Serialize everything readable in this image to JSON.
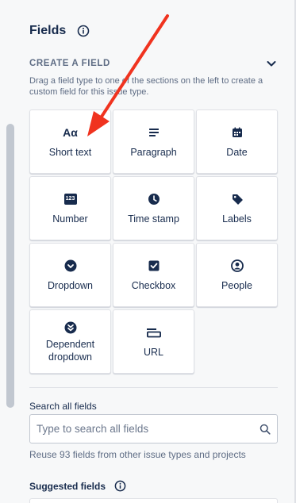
{
  "header": {
    "title": "Fields"
  },
  "create_section": {
    "title": "CREATE A FIELD",
    "description": "Drag a field type to one of the sections on the left to create a custom field for this issue type."
  },
  "field_types": [
    {
      "label": "Short text",
      "icon": "short-text-icon"
    },
    {
      "label": "Paragraph",
      "icon": "paragraph-icon"
    },
    {
      "label": "Date",
      "icon": "calendar-icon"
    },
    {
      "label": "Number",
      "icon": "number-icon"
    },
    {
      "label": "Time stamp",
      "icon": "clock-icon"
    },
    {
      "label": "Labels",
      "icon": "tag-icon"
    },
    {
      "label": "Dropdown",
      "icon": "dropdown-icon"
    },
    {
      "label": "Checkbox",
      "icon": "checkbox-icon"
    },
    {
      "label": "People",
      "icon": "person-icon"
    },
    {
      "label": "Dependent dropdown",
      "icon": "dependent-dropdown-icon"
    },
    {
      "label": "URL",
      "icon": "url-icon"
    }
  ],
  "icon_glyphs": {
    "short_text": "Aα",
    "number": "123"
  },
  "search": {
    "label": "Search all fields",
    "placeholder": "Type to search all fields",
    "value": "",
    "help": "Reuse 93 fields from other issue types and projects"
  },
  "suggested": {
    "title": "Suggested fields"
  },
  "colors": {
    "icon": "#172b4d",
    "annotation_arrow": "#f0331f",
    "secondary_text": "#5e6c84"
  }
}
